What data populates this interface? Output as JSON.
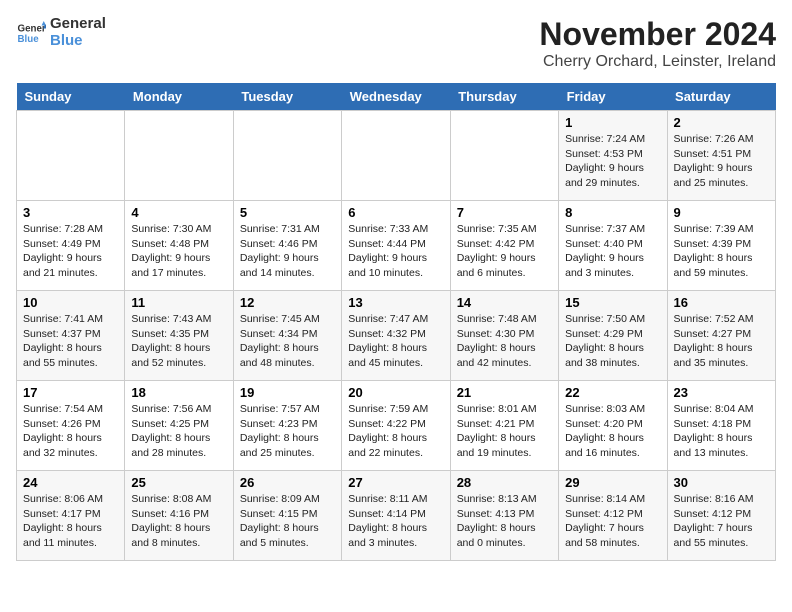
{
  "logo": {
    "line1": "General",
    "line2": "Blue"
  },
  "title": "November 2024",
  "location": "Cherry Orchard, Leinster, Ireland",
  "headers": [
    "Sunday",
    "Monday",
    "Tuesday",
    "Wednesday",
    "Thursday",
    "Friday",
    "Saturday"
  ],
  "weeks": [
    [
      {
        "day": "",
        "info": ""
      },
      {
        "day": "",
        "info": ""
      },
      {
        "day": "",
        "info": ""
      },
      {
        "day": "",
        "info": ""
      },
      {
        "day": "",
        "info": ""
      },
      {
        "day": "1",
        "info": "Sunrise: 7:24 AM\nSunset: 4:53 PM\nDaylight: 9 hours\nand 29 minutes."
      },
      {
        "day": "2",
        "info": "Sunrise: 7:26 AM\nSunset: 4:51 PM\nDaylight: 9 hours\nand 25 minutes."
      }
    ],
    [
      {
        "day": "3",
        "info": "Sunrise: 7:28 AM\nSunset: 4:49 PM\nDaylight: 9 hours\nand 21 minutes."
      },
      {
        "day": "4",
        "info": "Sunrise: 7:30 AM\nSunset: 4:48 PM\nDaylight: 9 hours\nand 17 minutes."
      },
      {
        "day": "5",
        "info": "Sunrise: 7:31 AM\nSunset: 4:46 PM\nDaylight: 9 hours\nand 14 minutes."
      },
      {
        "day": "6",
        "info": "Sunrise: 7:33 AM\nSunset: 4:44 PM\nDaylight: 9 hours\nand 10 minutes."
      },
      {
        "day": "7",
        "info": "Sunrise: 7:35 AM\nSunset: 4:42 PM\nDaylight: 9 hours\nand 6 minutes."
      },
      {
        "day": "8",
        "info": "Sunrise: 7:37 AM\nSunset: 4:40 PM\nDaylight: 9 hours\nand 3 minutes."
      },
      {
        "day": "9",
        "info": "Sunrise: 7:39 AM\nSunset: 4:39 PM\nDaylight: 8 hours\nand 59 minutes."
      }
    ],
    [
      {
        "day": "10",
        "info": "Sunrise: 7:41 AM\nSunset: 4:37 PM\nDaylight: 8 hours\nand 55 minutes."
      },
      {
        "day": "11",
        "info": "Sunrise: 7:43 AM\nSunset: 4:35 PM\nDaylight: 8 hours\nand 52 minutes."
      },
      {
        "day": "12",
        "info": "Sunrise: 7:45 AM\nSunset: 4:34 PM\nDaylight: 8 hours\nand 48 minutes."
      },
      {
        "day": "13",
        "info": "Sunrise: 7:47 AM\nSunset: 4:32 PM\nDaylight: 8 hours\nand 45 minutes."
      },
      {
        "day": "14",
        "info": "Sunrise: 7:48 AM\nSunset: 4:30 PM\nDaylight: 8 hours\nand 42 minutes."
      },
      {
        "day": "15",
        "info": "Sunrise: 7:50 AM\nSunset: 4:29 PM\nDaylight: 8 hours\nand 38 minutes."
      },
      {
        "day": "16",
        "info": "Sunrise: 7:52 AM\nSunset: 4:27 PM\nDaylight: 8 hours\nand 35 minutes."
      }
    ],
    [
      {
        "day": "17",
        "info": "Sunrise: 7:54 AM\nSunset: 4:26 PM\nDaylight: 8 hours\nand 32 minutes."
      },
      {
        "day": "18",
        "info": "Sunrise: 7:56 AM\nSunset: 4:25 PM\nDaylight: 8 hours\nand 28 minutes."
      },
      {
        "day": "19",
        "info": "Sunrise: 7:57 AM\nSunset: 4:23 PM\nDaylight: 8 hours\nand 25 minutes."
      },
      {
        "day": "20",
        "info": "Sunrise: 7:59 AM\nSunset: 4:22 PM\nDaylight: 8 hours\nand 22 minutes."
      },
      {
        "day": "21",
        "info": "Sunrise: 8:01 AM\nSunset: 4:21 PM\nDaylight: 8 hours\nand 19 minutes."
      },
      {
        "day": "22",
        "info": "Sunrise: 8:03 AM\nSunset: 4:20 PM\nDaylight: 8 hours\nand 16 minutes."
      },
      {
        "day": "23",
        "info": "Sunrise: 8:04 AM\nSunset: 4:18 PM\nDaylight: 8 hours\nand 13 minutes."
      }
    ],
    [
      {
        "day": "24",
        "info": "Sunrise: 8:06 AM\nSunset: 4:17 PM\nDaylight: 8 hours\nand 11 minutes."
      },
      {
        "day": "25",
        "info": "Sunrise: 8:08 AM\nSunset: 4:16 PM\nDaylight: 8 hours\nand 8 minutes."
      },
      {
        "day": "26",
        "info": "Sunrise: 8:09 AM\nSunset: 4:15 PM\nDaylight: 8 hours\nand 5 minutes."
      },
      {
        "day": "27",
        "info": "Sunrise: 8:11 AM\nSunset: 4:14 PM\nDaylight: 8 hours\nand 3 minutes."
      },
      {
        "day": "28",
        "info": "Sunrise: 8:13 AM\nSunset: 4:13 PM\nDaylight: 8 hours\nand 0 minutes."
      },
      {
        "day": "29",
        "info": "Sunrise: 8:14 AM\nSunset: 4:12 PM\nDaylight: 7 hours\nand 58 minutes."
      },
      {
        "day": "30",
        "info": "Sunrise: 8:16 AM\nSunset: 4:12 PM\nDaylight: 7 hours\nand 55 minutes."
      }
    ]
  ]
}
